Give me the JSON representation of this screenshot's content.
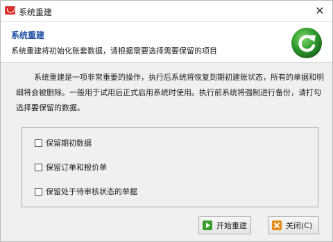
{
  "window": {
    "title": "系统重建",
    "close_glyph": "✕"
  },
  "banner": {
    "title": "系统重建",
    "subtitle": "系统重建将初始化账套数据，请根据需要选择需要保留的项目",
    "icon": "refresh-icon",
    "icon_color": "#2e9a2e"
  },
  "description": "系统重建是一项非常重要的操作，执行后系统将恢复到期初建账状态，所有的单据和明细将会被删除。一般用于试用后正式启用系统时使用。执行前系统将强制进行备份，请打勾选择要保留的数据。",
  "options": [
    {
      "label": "保留期初数据",
      "checked": false
    },
    {
      "label": "保留订单和报价单",
      "checked": false
    },
    {
      "label": "保留处于待审核状态的单据",
      "checked": false
    }
  ],
  "buttons": {
    "start": {
      "label": "开始重建",
      "icon": "play-icon",
      "color": "#3a9d2e"
    },
    "close": {
      "label": "关闭(C)",
      "icon": "close-icon",
      "color": "#e58b17"
    }
  }
}
